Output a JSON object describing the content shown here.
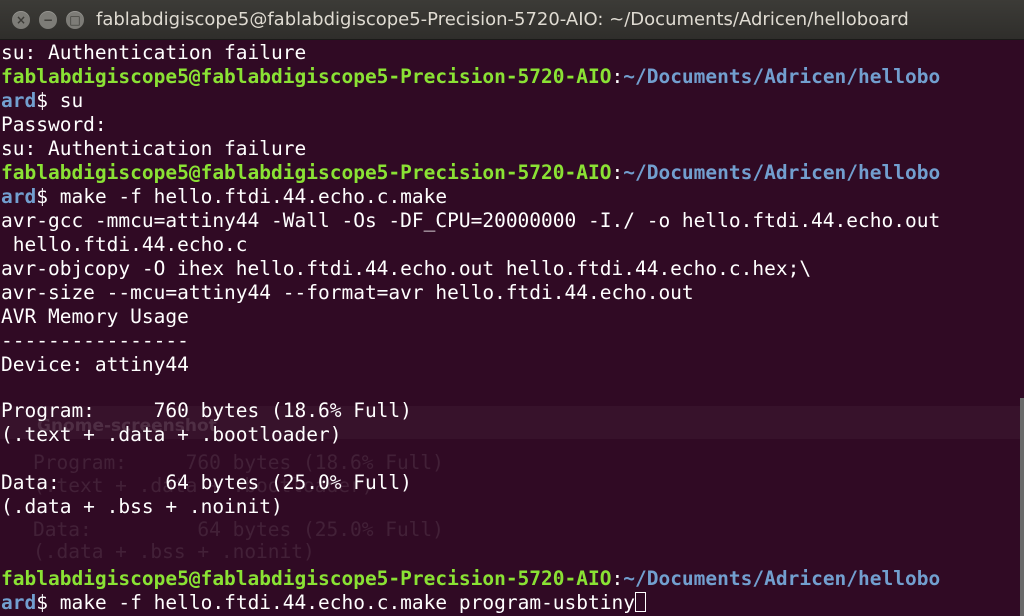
{
  "window": {
    "title": "fablabdigiscope5@fablabdigiscope5-Precision-5720-AIO: ~/Documents/Adricen/helloboard",
    "close_glyph": "×",
    "minimize_glyph": "−",
    "maximize_glyph": "□"
  },
  "terminal": {
    "line_01": "su: Authentication failure",
    "prompt_user_host": "fablabdigiscope5@fablabdigiscope5-Precision-5720-AIO",
    "prompt_separator": ":",
    "prompt_path_1": "~/Documents/Adricen/hellobo",
    "prompt_path_2": "ard",
    "prompt_dollar": "$",
    "cmd_su": " su",
    "line_password": "Password:",
    "line_auth_fail_2": "su: Authentication failure",
    "cmd_make": " make -f hello.ftdi.44.echo.c.make",
    "line_gcc_1": "avr-gcc -mmcu=attiny44 -Wall -Os -DF_CPU=20000000 -I./ -o hello.ftdi.44.echo.out",
    "line_gcc_2": " hello.ftdi.44.echo.c",
    "line_objcopy": "avr-objcopy -O ihex hello.ftdi.44.echo.out hello.ftdi.44.echo.c.hex;\\",
    "line_size": "avr-size --mcu=attiny44 --format=avr hello.ftdi.44.echo.out",
    "line_usage": "AVR Memory Usage",
    "line_dashes": "----------------",
    "line_device": "Device: attiny44",
    "line_program": "Program:     760 bytes (18.6% Full)",
    "line_program_detail": "(.text + .data + .bootloader)",
    "line_data": "Data:         64 bytes (25.0% Full)",
    "line_data_detail": "(.data + .bss + .noinit)",
    "cmd_program": " make -f hello.ftdi.44.echo.c.make program-usbtiny"
  },
  "overlay": {
    "title": "Gnome-screenshot",
    "program": "Program:     760 bytes (18.6% Full)",
    "program_detail": "(.text + .data + .bootloader)",
    "data": "Data:         64 bytes (25.0% Full)",
    "data_detail": "(.data + .bss + .noinit)"
  },
  "colors": {
    "background": "#300a24",
    "prompt_user": "#8ae234",
    "prompt_path": "#729fcf",
    "text": "#ffffff"
  }
}
